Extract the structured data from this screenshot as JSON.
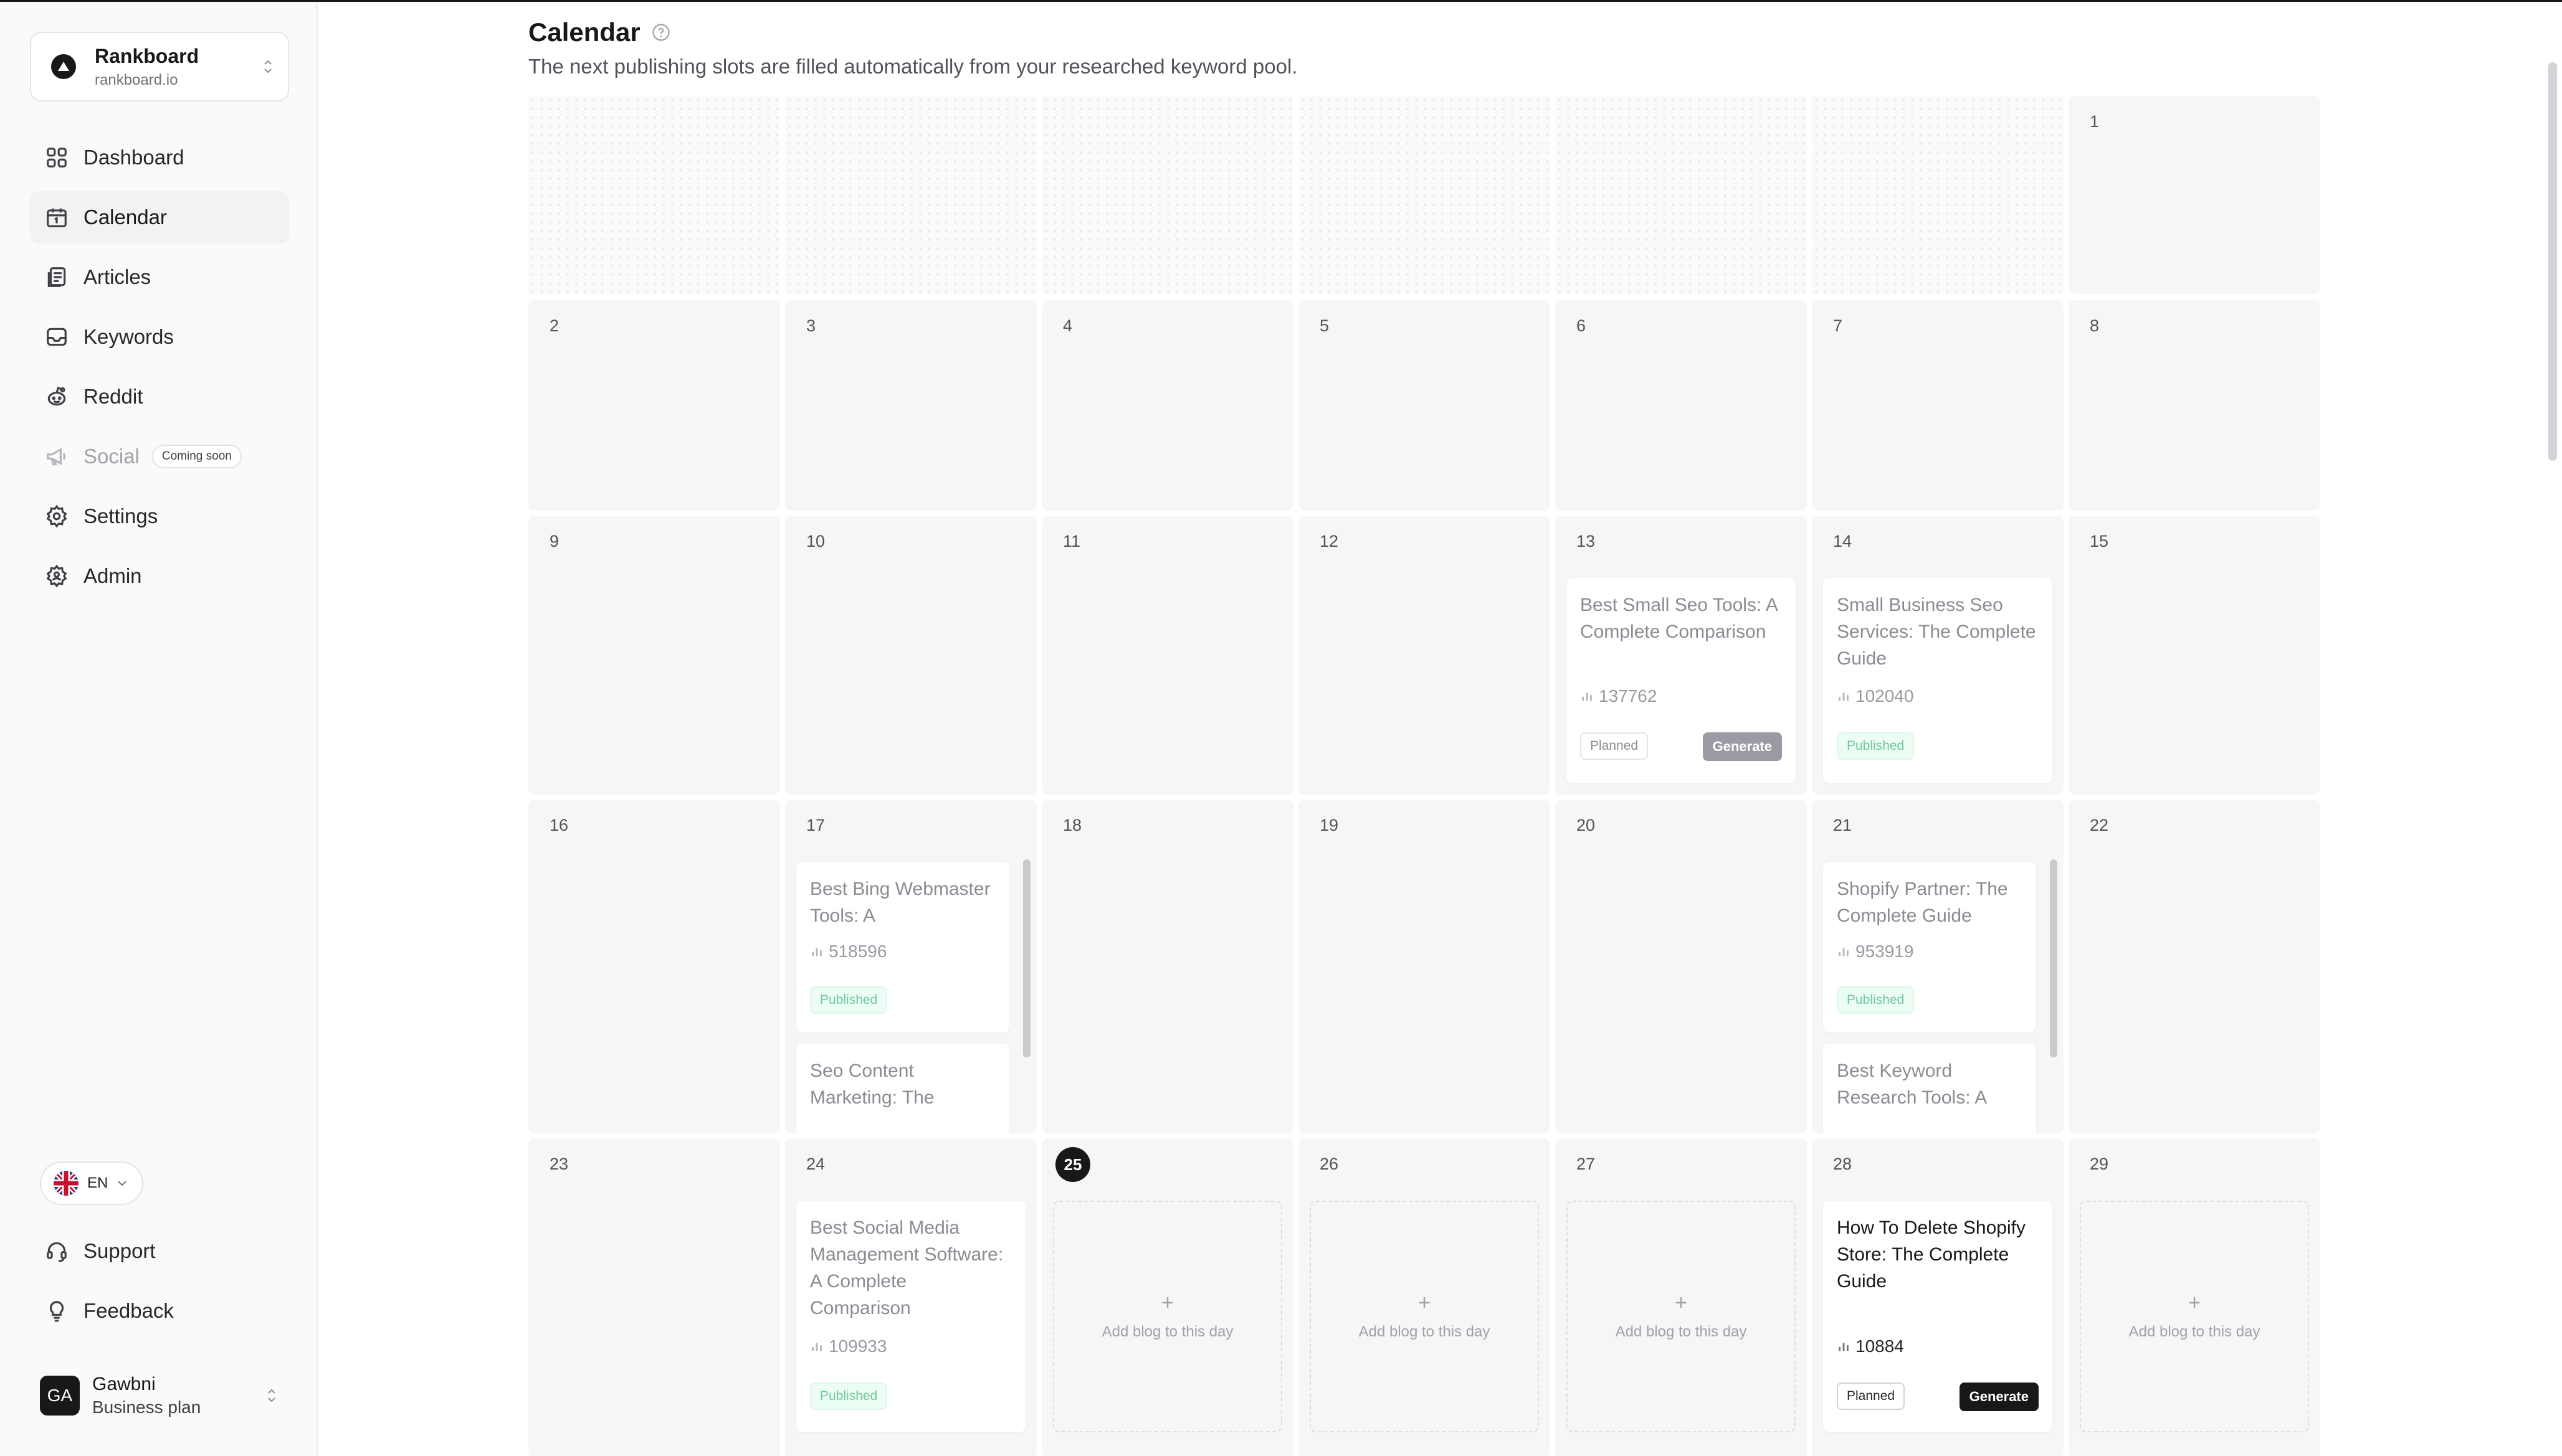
{
  "workspace": {
    "name": "Rankboard",
    "domain": "rankboard.io"
  },
  "nav": [
    {
      "label": "Dashboard",
      "icon": "dashboard-icon"
    },
    {
      "label": "Calendar",
      "icon": "calendar-icon",
      "active": true
    },
    {
      "label": "Articles",
      "icon": "articles-icon"
    },
    {
      "label": "Keywords",
      "icon": "keywords-icon"
    },
    {
      "label": "Reddit",
      "icon": "reddit-icon"
    },
    {
      "label": "Social",
      "icon": "megaphone-icon",
      "disabled": true,
      "badge": "Coming soon"
    },
    {
      "label": "Settings",
      "icon": "gear-icon"
    },
    {
      "label": "Admin",
      "icon": "admin-icon"
    }
  ],
  "language": {
    "code": "EN"
  },
  "bottom_nav": [
    {
      "label": "Support",
      "icon": "headset-icon"
    },
    {
      "label": "Feedback",
      "icon": "lightbulb-icon"
    }
  ],
  "user": {
    "initials": "GA",
    "name": "Gawbni",
    "plan": "Business plan"
  },
  "page": {
    "title": "Calendar",
    "subtitle": "The next publishing slots are filled automatically from your researched keyword pool."
  },
  "calendar": {
    "today": 25,
    "add_label": "Add blog to this day",
    "add_plus": "+",
    "generate_label": "Generate",
    "days": [
      "1",
      "2",
      "3",
      "4",
      "5",
      "6",
      "7",
      "8",
      "9",
      "10",
      "11",
      "12",
      "13",
      "14",
      "15",
      "16",
      "17",
      "18",
      "19",
      "20",
      "21",
      "22",
      "23",
      "24",
      "25",
      "26",
      "27",
      "28",
      "29"
    ],
    "entries": [
      {
        "day": 13,
        "title": "Best Small Seo Tools: A Complete Comparison",
        "metric": "137762",
        "status": "Planned",
        "generate": true
      },
      {
        "day": 14,
        "title": "Small Business Seo Services: The Complete Guide",
        "metric": "102040",
        "status": "Published"
      },
      {
        "day": 17,
        "title": "Best Bing Webmaster Tools: A",
        "metric": "518596",
        "status": "Published"
      },
      {
        "day": 17,
        "title": "Seo Content Marketing: The"
      },
      {
        "day": 21,
        "title": "Shopify Partner: The Complete Guide",
        "metric": "953919",
        "status": "Published"
      },
      {
        "day": 21,
        "title": "Best Keyword Research Tools: A"
      },
      {
        "day": 24,
        "title": "Best Social Media Management Software: A Complete Comparison",
        "metric": "109933",
        "status": "Published"
      },
      {
        "day": 28,
        "title": "How To Delete Shopify Store: The Complete Guide",
        "metric": "10884",
        "status": "Planned",
        "generate": true
      }
    ],
    "empty_future_days": [
      25,
      26,
      27,
      29
    ]
  },
  "colors": {
    "accent": "#18181b",
    "published_bg": "#ecfdf3",
    "published_text": "#6fc79a",
    "cell_bg": "#f6f6f7"
  }
}
